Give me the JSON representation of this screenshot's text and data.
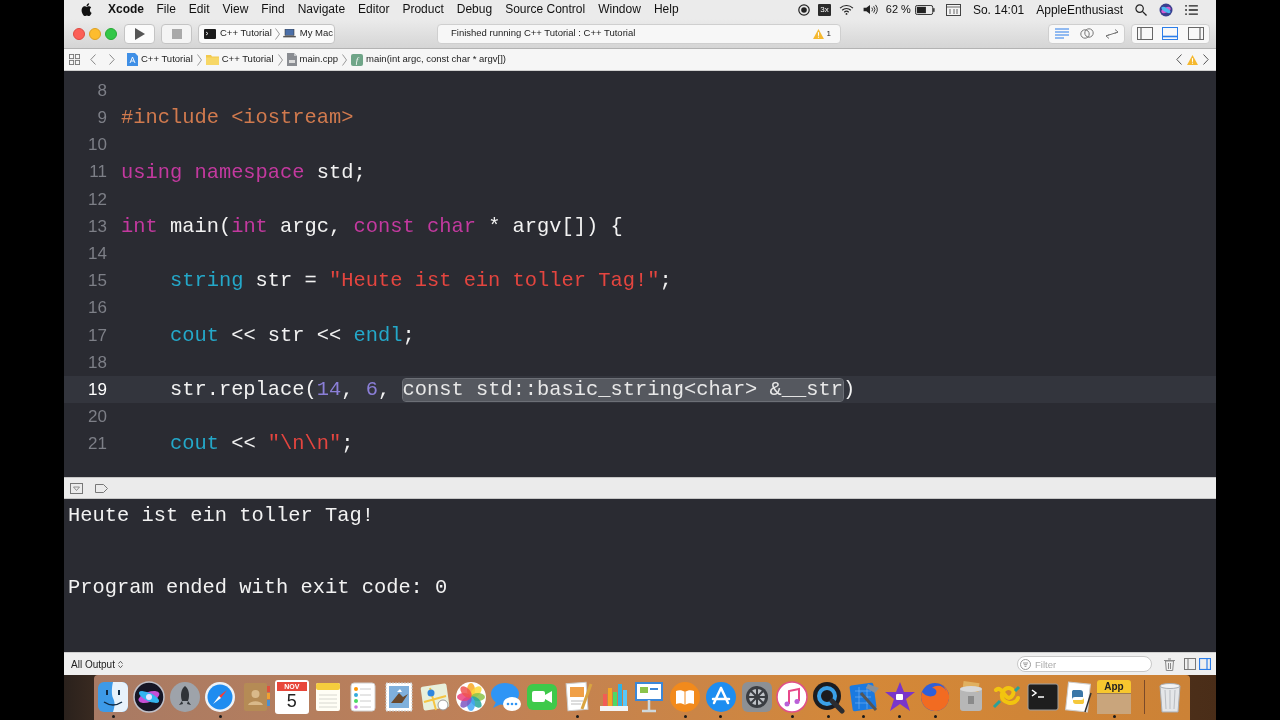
{
  "menu_bar": {
    "app_name": "Xcode",
    "menus": [
      "File",
      "Edit",
      "View",
      "Find",
      "Navigate",
      "Editor",
      "Product",
      "Debug",
      "Source Control",
      "Window",
      "Help"
    ],
    "display_badge": "3x",
    "battery": "62 %",
    "clock": "So. 14:01",
    "user": "AppleEnthusiast"
  },
  "toolbar": {
    "scheme": "C++ Tutorial",
    "destination": "My Mac",
    "activity": "Finished running C++ Tutorial : C++ Tutorial",
    "warning_count": "1",
    "editor_modes": [
      {
        "kind": "standard",
        "selected": true
      },
      {
        "kind": "assistant",
        "selected": false
      },
      {
        "kind": "version",
        "selected": false
      }
    ],
    "panels": [
      {
        "kind": "navigator",
        "selected": false
      },
      {
        "kind": "debug",
        "selected": true
      },
      {
        "kind": "utilities",
        "selected": false
      }
    ]
  },
  "jump_bar": {
    "path": [
      {
        "kind": "project",
        "label": "C++ Tutorial"
      },
      {
        "kind": "folder",
        "label": "C++ Tutorial"
      },
      {
        "kind": "file",
        "label": "main.cpp"
      },
      {
        "kind": "function",
        "badge": "f",
        "label": "main(int argc, const char * argv[])"
      }
    ]
  },
  "editor": {
    "lines": [
      {
        "number": "8",
        "selected": false
      },
      {
        "number": "9",
        "selected": false,
        "tokens": [
          {
            "kind": "preprocessor",
            "text": "#include <iostream>"
          }
        ]
      },
      {
        "number": "10",
        "selected": false
      },
      {
        "number": "11",
        "selected": false,
        "tokens": [
          {
            "kind": "keyword",
            "text": "using namespace"
          },
          {
            "kind": "plain",
            "text": " std;"
          }
        ]
      },
      {
        "number": "12",
        "selected": false
      },
      {
        "number": "13",
        "selected": false,
        "tokens": [
          {
            "kind": "keyword",
            "text": "int"
          },
          {
            "kind": "plain",
            "text": " main("
          },
          {
            "kind": "keyword",
            "text": "int"
          },
          {
            "kind": "plain",
            "text": " argc, "
          },
          {
            "kind": "keyword",
            "text": "const char"
          },
          {
            "kind": "plain",
            "text": " * argv[]) {"
          }
        ]
      },
      {
        "number": "14",
        "selected": false
      },
      {
        "number": "15",
        "selected": false,
        "tokens": [
          {
            "kind": "type",
            "text": "    string"
          },
          {
            "kind": "plain",
            "text": " str = "
          },
          {
            "kind": "string",
            "text": "\"Heute ist ein toller Tag!\""
          },
          {
            "kind": "plain",
            "text": ";"
          }
        ]
      },
      {
        "number": "16",
        "selected": false
      },
      {
        "number": "17",
        "selected": false,
        "tokens": [
          {
            "kind": "type",
            "text": "    cout"
          },
          {
            "kind": "plain",
            "text": " << str << "
          },
          {
            "kind": "type",
            "text": "endl"
          },
          {
            "kind": "plain",
            "text": ";"
          }
        ]
      },
      {
        "number": "18",
        "selected": false
      },
      {
        "number": "19",
        "selected": true,
        "tokens": [
          {
            "kind": "plain",
            "text": "    str.replace("
          },
          {
            "kind": "number",
            "text": "14"
          },
          {
            "kind": "plain",
            "text": ", "
          },
          {
            "kind": "number",
            "text": "6"
          },
          {
            "kind": "plain",
            "text": ", "
          },
          {
            "kind": "placeholder",
            "text": "const std::basic_string<char> &__str"
          },
          {
            "kind": "plain",
            "text": ")"
          }
        ]
      },
      {
        "number": "20",
        "selected": false
      },
      {
        "number": "21",
        "selected": false,
        "tokens": [
          {
            "kind": "type",
            "text": "    cout"
          },
          {
            "kind": "plain",
            "text": " << "
          },
          {
            "kind": "string",
            "text": "\"\\n\\n\""
          },
          {
            "kind": "plain",
            "text": ";"
          }
        ]
      }
    ]
  },
  "console": {
    "output": "Heute ist ein toller Tag!\n\n\nProgram ended with exit code: 0",
    "scope": "All Output",
    "filter_placeholder": "Filter",
    "panes": [
      {
        "kind": "variables",
        "selected": false
      },
      {
        "kind": "console",
        "selected": true
      }
    ]
  },
  "dock": {
    "items": [
      {
        "kind": "face",
        "running": true
      },
      {
        "kind": "orb",
        "running": false
      },
      {
        "kind": "rocket",
        "running": false
      },
      {
        "kind": "compass",
        "running": true
      },
      {
        "kind": "book",
        "running": false
      },
      {
        "kind": "calendar",
        "month": "NOV",
        "day": "5",
        "running": false
      },
      {
        "kind": "notepad",
        "running": false
      },
      {
        "kind": "checklist",
        "running": false
      },
      {
        "kind": "stamp",
        "running": false
      },
      {
        "kind": "map",
        "running": false
      },
      {
        "kind": "flower",
        "running": false
      },
      {
        "kind": "bubble",
        "running": false
      },
      {
        "kind": "camera",
        "running": false
      },
      {
        "kind": "document",
        "running": true
      },
      {
        "kind": "chart",
        "running": false
      },
      {
        "kind": "lectern",
        "running": false
      },
      {
        "kind": "open_book",
        "running": true
      },
      {
        "kind": "a_letter",
        "running": true
      },
      {
        "kind": "gear",
        "running": false
      },
      {
        "kind": "music",
        "running": true
      },
      {
        "kind": "q_ring",
        "running": true
      },
      {
        "kind": "blueprint",
        "running": true
      },
      {
        "kind": "star",
        "running": true
      },
      {
        "kind": "globe",
        "running": true
      },
      {
        "kind": "tin",
        "running": false
      },
      {
        "kind": "knot",
        "running": false
      },
      {
        "kind": "terminal",
        "running": false
      },
      {
        "kind": "snake_doc",
        "running": false
      },
      {
        "kind": "package",
        "label": "App",
        "running": true
      },
      {
        "kind": "trash",
        "running": false
      }
    ]
  }
}
